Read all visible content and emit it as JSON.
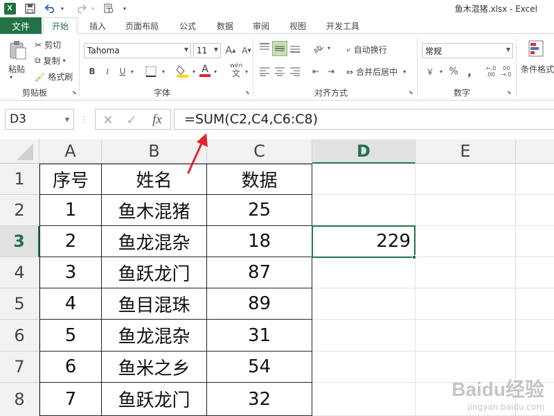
{
  "window": {
    "title": "鱼木混猪.xlsx - Excel"
  },
  "tabs": [
    {
      "label": "文件"
    },
    {
      "label": "开始"
    },
    {
      "label": "插入"
    },
    {
      "label": "页面布局"
    },
    {
      "label": "公式"
    },
    {
      "label": "数据"
    },
    {
      "label": "审阅"
    },
    {
      "label": "视图"
    },
    {
      "label": "开发工具"
    }
  ],
  "ribbon": {
    "clipboard": {
      "paste": "粘贴",
      "cut": "剪切",
      "copy": "复制",
      "format_painter": "格式刷",
      "label": "剪贴板"
    },
    "font": {
      "name": "Tahoma",
      "size": "11",
      "bold": "B",
      "italic": "I",
      "underline": "U",
      "font_color": "A",
      "phonetic": "wén",
      "label": "字体"
    },
    "alignment": {
      "wrap_text": "自动换行",
      "merge_center": "合并后居中",
      "label": "对齐方式"
    },
    "number": {
      "format": "常规",
      "currency": "￥",
      "percent": "%",
      "comma": ",",
      "label": "数字"
    },
    "styles": {
      "conditional_format": "条件格式"
    }
  },
  "formula_bar": {
    "name_box": "D3",
    "cancel": "✕",
    "enter": "✓",
    "fx": "fx",
    "formula": "=SUM(C2,C4,C6:C8)"
  },
  "sheet": {
    "columns": [
      "A",
      "B",
      "C",
      "D",
      "E"
    ],
    "rows": [
      "1",
      "2",
      "3",
      "4",
      "5",
      "6",
      "7",
      "8"
    ],
    "header_row": [
      "序号",
      "姓名",
      "数据"
    ],
    "data": [
      [
        "1",
        "鱼木混猪",
        "25"
      ],
      [
        "2",
        "鱼龙混杂",
        "18"
      ],
      [
        "3",
        "鱼跃龙门",
        "87"
      ],
      [
        "4",
        "鱼目混珠",
        "89"
      ],
      [
        "5",
        "鱼龙混杂",
        "31"
      ],
      [
        "6",
        "鱼米之乡",
        "54"
      ],
      [
        "7",
        "鱼跃龙门",
        "32"
      ]
    ],
    "result_cell_value": "229",
    "selected_column": "D",
    "selected_row": "3"
  },
  "watermark": {
    "brand": "Baidu经验",
    "url": "jingyan.baidu.com"
  },
  "colors": {
    "excel_green": "#217346",
    "arrow_red": "#e0262a"
  }
}
